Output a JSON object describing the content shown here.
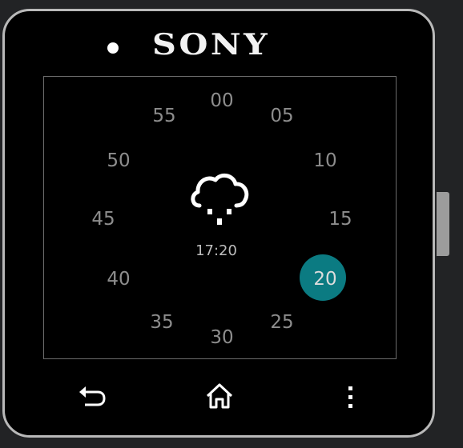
{
  "device": {
    "brand": "SONY"
  },
  "dial": {
    "minutes": [
      "00",
      "05",
      "10",
      "15",
      "20",
      "25",
      "30",
      "35",
      "40",
      "45",
      "50",
      "55"
    ],
    "selected": "20",
    "accent_color": "#0b7b82"
  },
  "center": {
    "weather_icon": "rain-cloud-icon",
    "time": "17:20"
  },
  "nav": {
    "back_icon": "back-arrow-icon",
    "home_icon": "home-icon",
    "menu_icon": "overflow-menu-icon"
  }
}
